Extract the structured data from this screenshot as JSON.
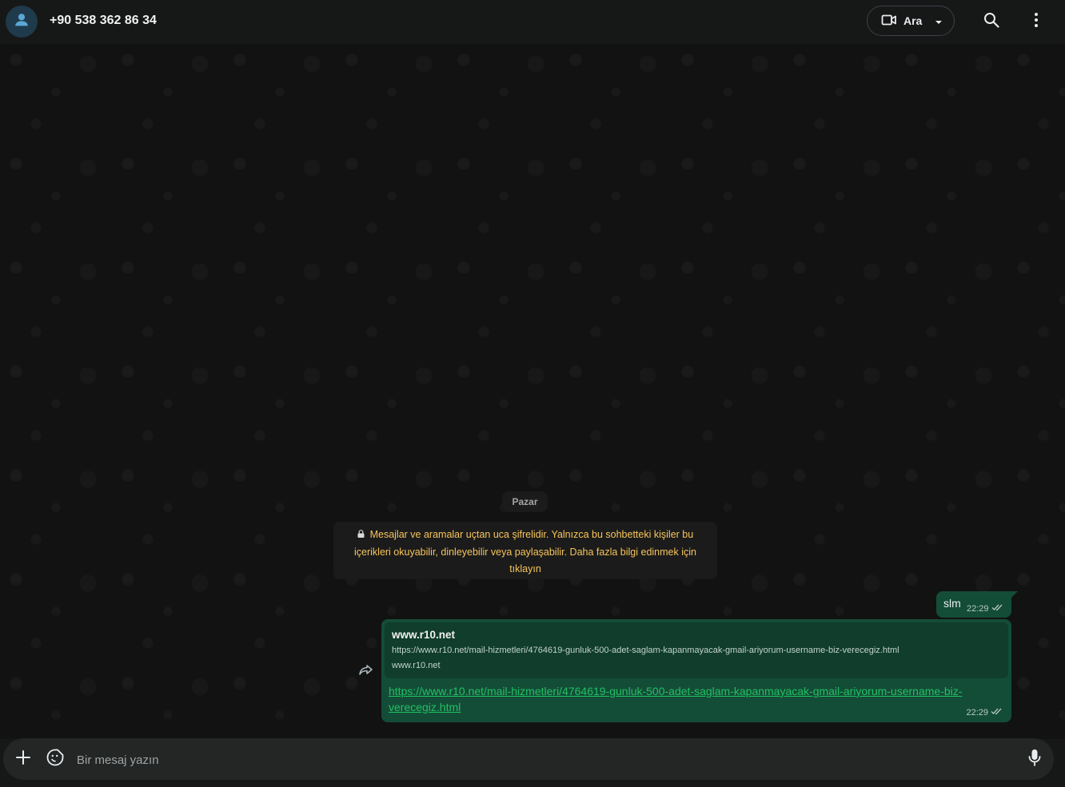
{
  "header": {
    "contact_name": "+90 538 362 86 34",
    "call_label": "Ara",
    "icons": [
      "person-icon",
      "video-icon",
      "chevron-down-icon",
      "search-icon",
      "more-vert-icon"
    ]
  },
  "chat": {
    "date_chip": "Pazar",
    "encryption_notice": "Mesajlar ve aramalar uçtan uca şifrelidir. Yalnızca bu sohbetteki kişiler bu içerikleri okuyabilir, dinleyebilir veya paylaşabilir. Daha fazla bilgi edinmek için tıklayın",
    "messages": [
      {
        "text": "slm",
        "time": "22:29",
        "status": "read"
      },
      {
        "preview_title": "www.r10.net",
        "preview_description": "https://www.r10.net/mail-hizmetleri/4764619-gunluk-500-adet-saglam-kapanmayacak-gmail-ariyorum-username-biz-verecegiz.html",
        "preview_domain": "www.r10.net",
        "link_text": "https://www.r10.net/mail-hizmetleri/4764619-gunluk-500-adet-saglam-kapanmayacak-gmail-ariyorum-username-biz-verecegiz.html",
        "time": "22:29",
        "status": "read"
      }
    ]
  },
  "composer": {
    "placeholder": "Bir mesaj yazın"
  },
  "colors": {
    "outgoing_bubble": "#144d37",
    "link": "#21c063",
    "notice_text": "#f7c55a"
  }
}
